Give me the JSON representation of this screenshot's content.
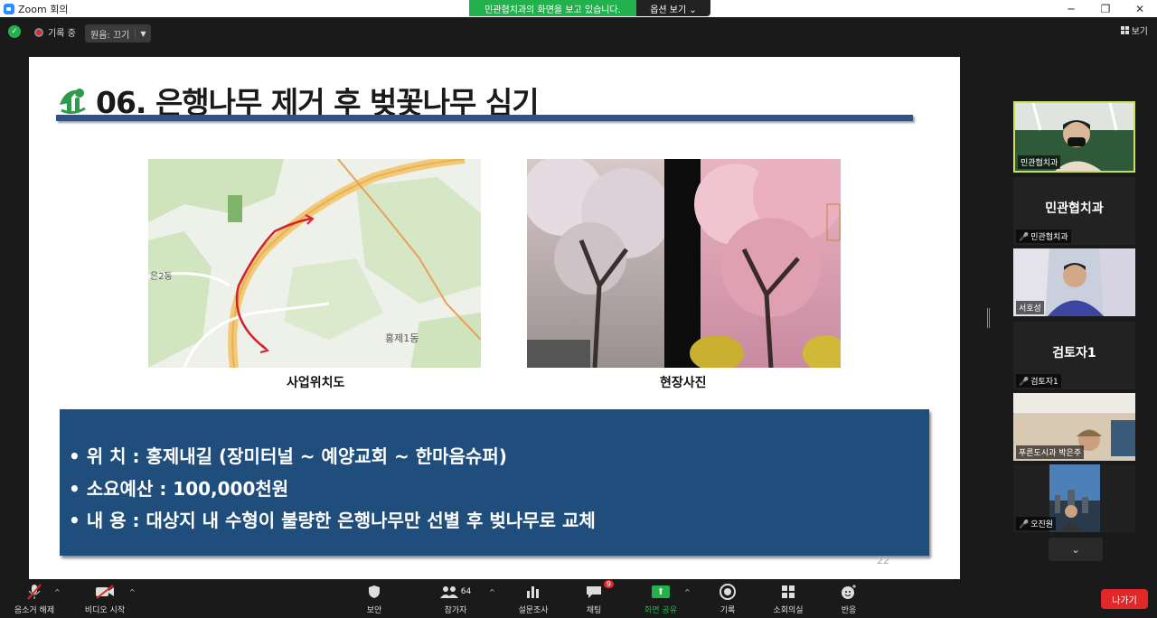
{
  "window": {
    "title": "Zoom 회의"
  },
  "share_banner": {
    "message": "민관협치과의 화면을 보고 있습니다.",
    "options": "옵션 보기"
  },
  "topbar": {
    "recording": "기록 중",
    "audio_label": "원음: 끄기",
    "view_label": "보기"
  },
  "slide": {
    "title": "06. 은행나무 제거 후 벚꽃나무 심기",
    "map_caption": "사업위치도",
    "photo_caption": "현장사진",
    "map_labels": {
      "district": "은2동",
      "area": "홍제1동"
    },
    "bullets": [
      {
        "key": "• 위      치",
        "value": ": 홍제내길 (장미터널 ~ 예양교회 ~ 한마음슈퍼)"
      },
      {
        "key": "• 소요예산",
        "value": ": 100,000천원"
      },
      {
        "key": "• 내      용",
        "value": ": 대상지 내 수형이 불량한 은행나무만 선별 후 벚나무로 교체"
      }
    ],
    "page_number": "22"
  },
  "participants": [
    {
      "type": "video",
      "name": "민관협치과"
    },
    {
      "type": "name",
      "display": "민관협치과",
      "name": "민관협치과"
    },
    {
      "type": "video",
      "name": "서호성"
    },
    {
      "type": "name",
      "display": "검토자1",
      "name": "검토자1"
    },
    {
      "type": "video",
      "name": "푸른도시과 박은주"
    },
    {
      "type": "video",
      "name": "오진원"
    }
  ],
  "toolbar": {
    "mute": "음소거 해제",
    "video": "비디오 시작",
    "security": "보안",
    "participants": "참가자",
    "participants_count": "64",
    "polls": "설문조사",
    "chat": "채팅",
    "chat_badge": "9",
    "share": "화면 공유",
    "record": "기록",
    "breakout": "소회의실",
    "reactions": "반응",
    "leave": "나가기"
  },
  "colors": {
    "accent_green": "#23b14d",
    "leave_red": "#e02828",
    "slide_box": "#1f4e7c",
    "active_speaker": "#c8e05a"
  }
}
